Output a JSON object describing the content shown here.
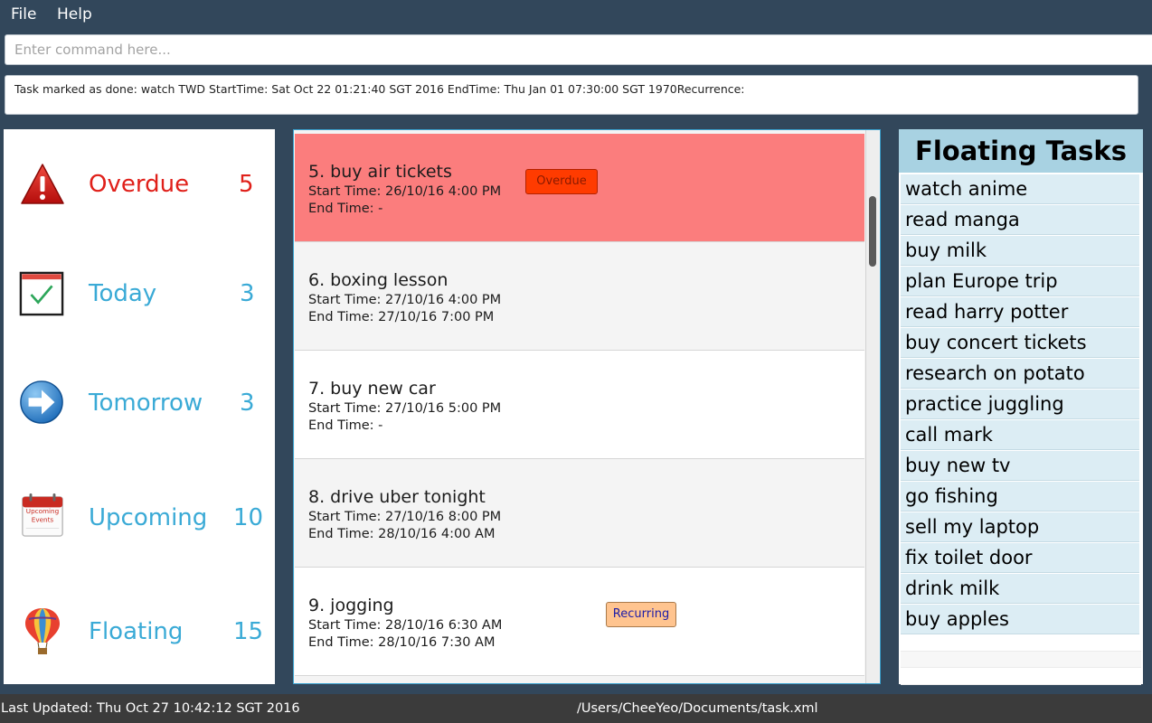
{
  "menu": {
    "file": "File",
    "help": "Help"
  },
  "command": {
    "placeholder": "Enter command here...",
    "value": ""
  },
  "result": {
    "text": "Task marked as done: watch TWD StartTime: Sat Oct 22 01:21:40 SGT 2016 EndTime: Thu Jan 01 07:30:00 SGT 1970Recurrence:"
  },
  "categories": [
    {
      "label": "Overdue",
      "count": "5",
      "color": "#e0201a",
      "icon": "warning-icon"
    },
    {
      "label": "Today",
      "count": "3",
      "color": "#3aaad6",
      "icon": "calendar-check-icon"
    },
    {
      "label": "Tomorrow",
      "count": "3",
      "color": "#3aaad6",
      "icon": "arrow-right-icon"
    },
    {
      "label": "Upcoming",
      "count": "10",
      "color": "#3aaad6",
      "icon": "upcoming-events-calendar-icon",
      "icon_text_1": "Upcoming",
      "icon_text_2": "Events"
    },
    {
      "label": "Floating",
      "count": "15",
      "color": "#3aaad6",
      "icon": "hot-air-balloon-icon"
    }
  ],
  "tasks": [
    {
      "title": "5. buy air tickets",
      "start": "Start Time: 26/10/16 4:00 PM",
      "end": "End Time: -",
      "badge": "Overdue",
      "background": "#fb7d7d"
    },
    {
      "title": "6. boxing lesson",
      "start": "Start Time: 27/10/16 4:00 PM",
      "end": "End Time: 27/10/16 7:00 PM",
      "background": "#f4f4f4"
    },
    {
      "title": "7. buy new car",
      "start": "Start Time: 27/10/16 5:00 PM",
      "end": "End Time: -",
      "background": "#ffffff"
    },
    {
      "title": "8. drive uber tonight",
      "start": "Start Time: 27/10/16 8:00 PM",
      "end": "End Time: 28/10/16 4:00 AM",
      "background": "#f4f4f4"
    },
    {
      "title": "9. jogging",
      "start": "Start Time: 28/10/16 6:30 AM",
      "end": "End Time: 28/10/16 7:30 AM",
      "badge": "Recurring",
      "background": "#ffffff"
    }
  ],
  "floating": {
    "title": "Floating Tasks",
    "items": [
      "watch anime",
      "read manga",
      "buy milk",
      "plan Europe trip",
      "read harry potter",
      "buy concert tickets",
      "research on potato",
      "practice juggling",
      "call mark",
      "buy new tv",
      "go fishing",
      "sell my laptop",
      "fix toilet door",
      "drink milk",
      "buy apples"
    ]
  },
  "status": {
    "last_updated": "Last Updated: Thu Oct 27 10:42:12 SGT 2016",
    "path": "/Users/CheeYeo/Documents/task.xml"
  },
  "colors": {
    "window_bg": "#32475b",
    "overdue_badge": "#ff3b00",
    "recurring_badge": "#ffc48f",
    "floating_header": "#a8d2e2",
    "floating_item": "#dcedf4",
    "list_border": "#3aa2cf"
  }
}
